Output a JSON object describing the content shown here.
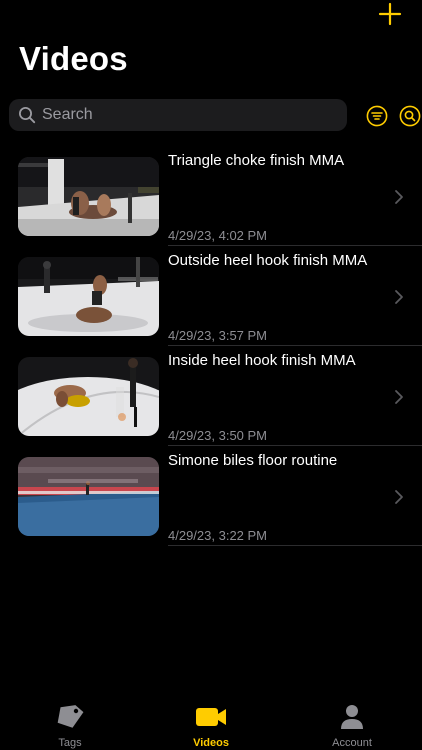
{
  "header": {
    "title": "Videos",
    "add_icon": "plus-icon"
  },
  "search": {
    "placeholder": "Search"
  },
  "toolbar": {
    "filter_icon": "filter-icon",
    "find_icon": "search-circle-icon"
  },
  "colors": {
    "accent": "#ffcc00",
    "background": "#000000",
    "search_bg": "#1c1c1e",
    "secondary_text": "#8e8e93",
    "inactive_tab": "#8e8e93",
    "divider": "#2c2c2e"
  },
  "videos": [
    {
      "title": "Triangle choke finish MMA",
      "date": "4/29/23, 4:02 PM"
    },
    {
      "title": "Outside heel hook finish MMA",
      "date": "4/29/23, 3:57 PM"
    },
    {
      "title": "Inside heel hook finish MMA",
      "date": "4/29/23, 3:50 PM"
    },
    {
      "title": "Simone biles floor routine",
      "date": "4/29/23, 3:22 PM"
    }
  ],
  "tabs": [
    {
      "label": "Tags",
      "icon": "tag-icon",
      "active": false
    },
    {
      "label": "Videos",
      "icon": "video-camera-icon",
      "active": true
    },
    {
      "label": "Account",
      "icon": "person-icon",
      "active": false
    }
  ]
}
